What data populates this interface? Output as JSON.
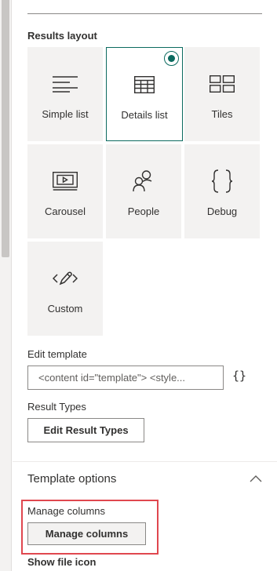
{
  "results_layout": {
    "label": "Results layout",
    "tiles": [
      {
        "label": "Simple list",
        "icon": "simple-list-icon",
        "selected": false
      },
      {
        "label": "Details list",
        "icon": "details-list-icon",
        "selected": true
      },
      {
        "label": "Tiles",
        "icon": "tiles-icon",
        "selected": false
      },
      {
        "label": "Carousel",
        "icon": "carousel-icon",
        "selected": false
      },
      {
        "label": "People",
        "icon": "people-icon",
        "selected": false
      },
      {
        "label": "Debug",
        "icon": "debug-braces-icon",
        "selected": false
      },
      {
        "label": "Custom",
        "icon": "custom-edit-icon",
        "selected": false
      }
    ]
  },
  "edit_template": {
    "label": "Edit template",
    "value": "<content id=\"template\">    <style...",
    "braces_button": "{}"
  },
  "result_types": {
    "label": "Result Types",
    "button_label": "Edit Result Types"
  },
  "template_options": {
    "header": "Template options",
    "manage_columns_label": "Manage columns",
    "manage_columns_button": "Manage columns",
    "show_file_icon_label": "Show file icon"
  },
  "colors": {
    "accent": "#0b6a5f",
    "tile_bg": "#f3f2f1",
    "highlight": "#e0474f",
    "scrollbar": "#c8c6c4"
  }
}
